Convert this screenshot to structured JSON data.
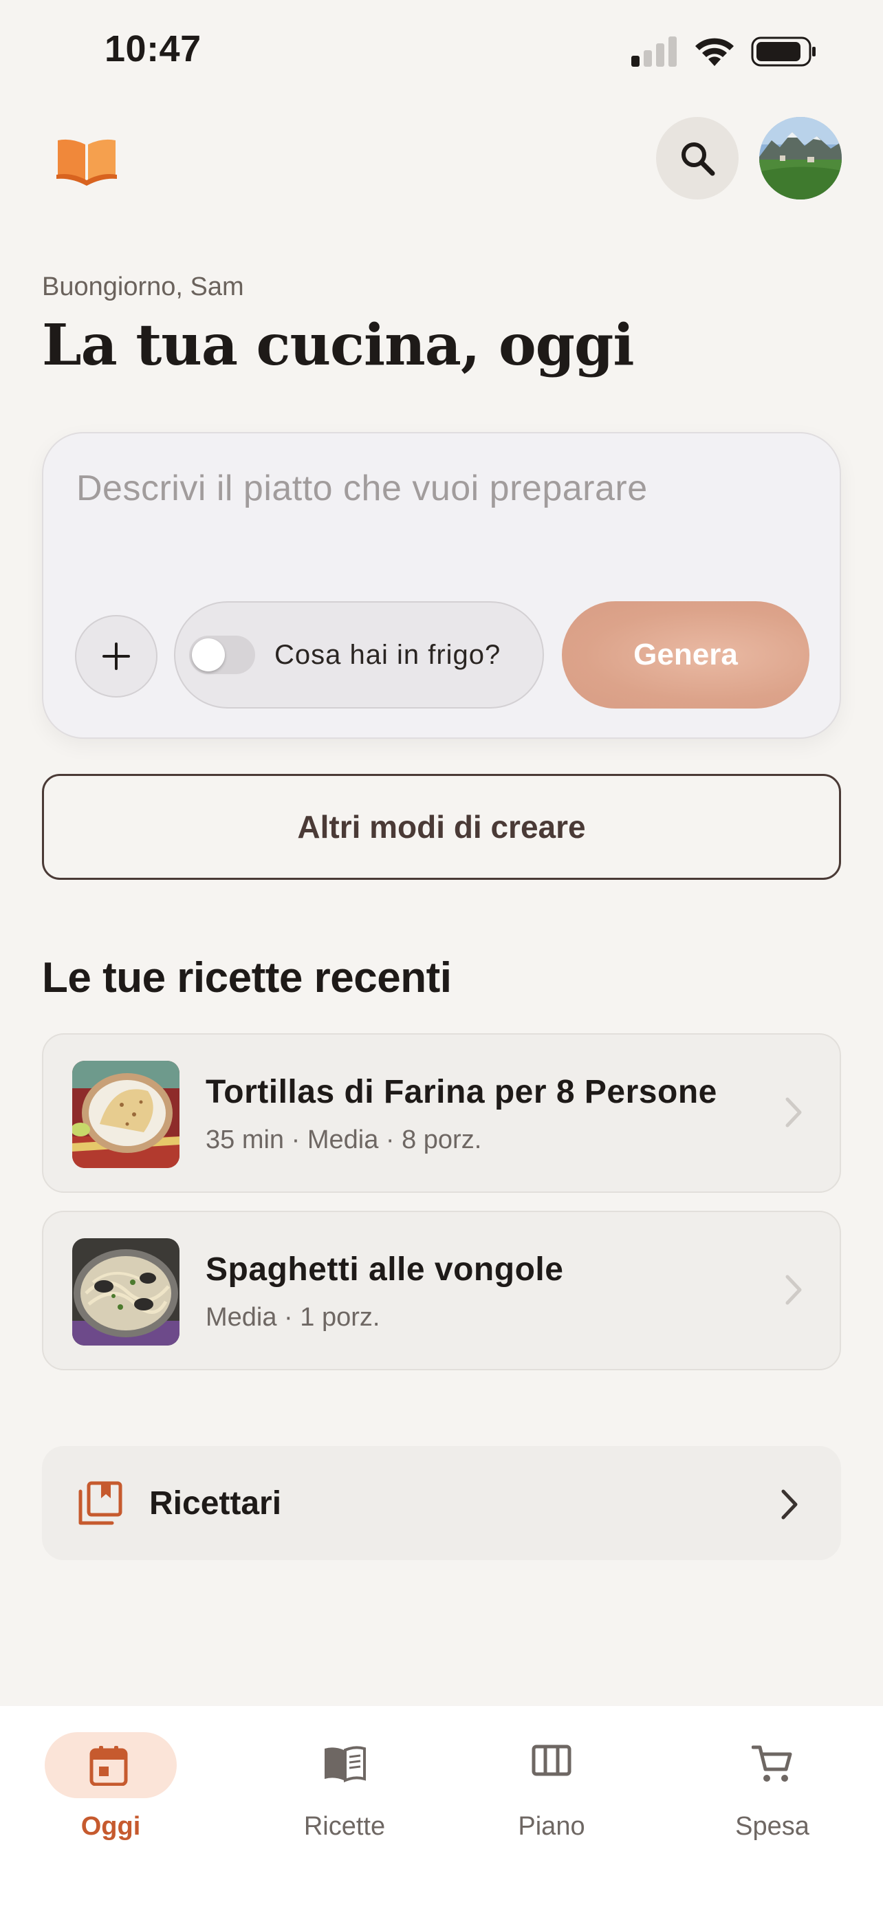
{
  "status_bar": {
    "time": "10:47"
  },
  "header": {
    "greeting": "Buongiorno, Sam",
    "title": "La tua cucina, oggi"
  },
  "prompt": {
    "placeholder": "Descrivi il piatto che vuoi preparare",
    "fridge_toggle_label": "Cosa hai in frigo?",
    "fridge_toggle_on": false,
    "generate_label": "Genera"
  },
  "more_ways_label": "Altri modi di creare",
  "recent": {
    "title": "Le tue ricette recenti",
    "items": [
      {
        "title": "Tortillas di Farina per 8 Persone",
        "meta": "35 min · Media · 8 porz."
      },
      {
        "title": "Spaghetti alle vongole",
        "meta": "Media · 1 porz."
      }
    ]
  },
  "cookbooks_label": "Ricettari",
  "tabs": [
    {
      "label": "Oggi",
      "icon": "calendar-icon",
      "active": true
    },
    {
      "label": "Ricette",
      "icon": "book-open-icon",
      "active": false
    },
    {
      "label": "Piano",
      "icon": "columns-icon",
      "active": false
    },
    {
      "label": "Spesa",
      "icon": "cart-icon",
      "active": false
    }
  ],
  "colors": {
    "accent": "#C65A2E",
    "generate": "#DCA38A",
    "background": "#F6F4F1",
    "outline": "#4A3A36"
  }
}
